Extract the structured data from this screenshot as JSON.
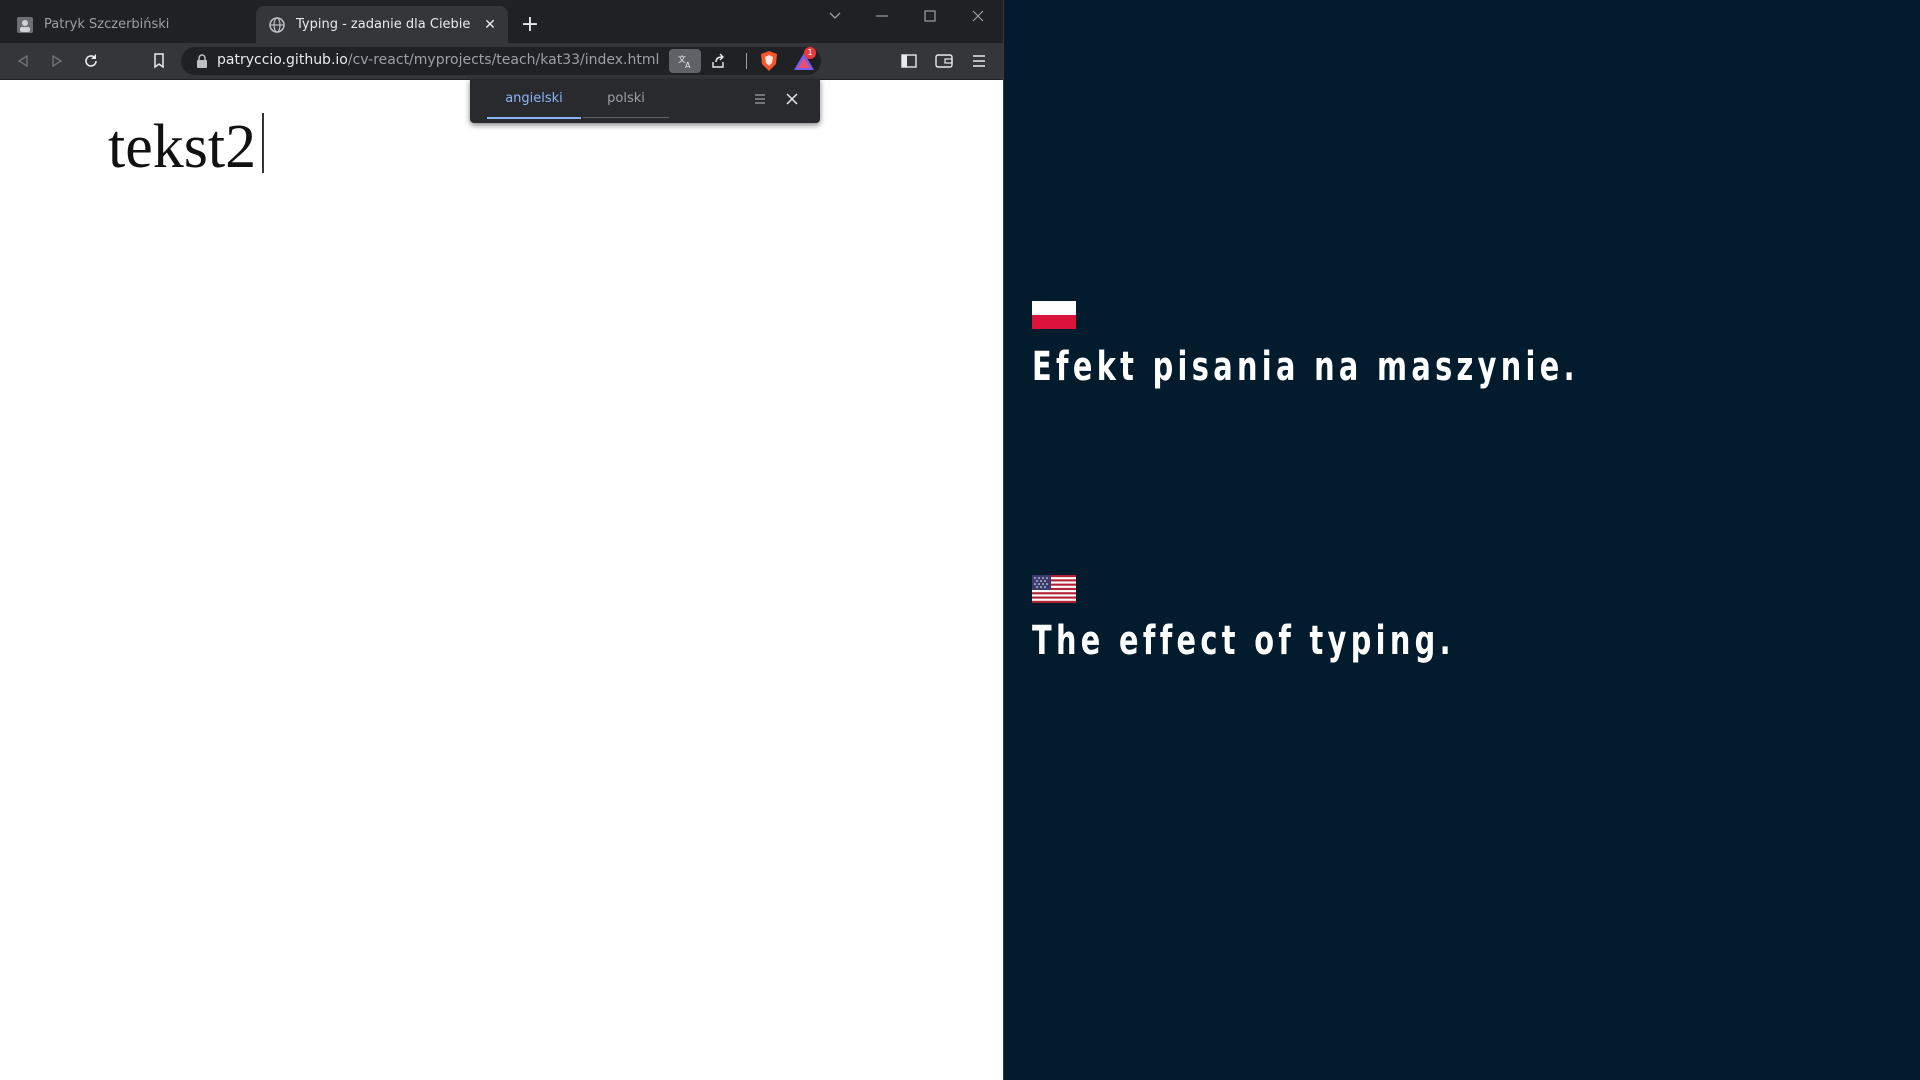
{
  "browser": {
    "tabs": [
      {
        "label": "Patryk Szczerbiński",
        "active": false,
        "icon": "avatar-favicon"
      },
      {
        "label": "Typing - zadanie dla Ciebie",
        "active": true,
        "icon": "globe-favicon"
      }
    ],
    "url": {
      "host": "patryccio.github.io",
      "path": "/cv-react/myprojects/teach/kat33/index.html"
    },
    "rewards_badge": "1"
  },
  "translate_popup": {
    "languages": [
      "angielski",
      "polski"
    ],
    "selected": "angielski"
  },
  "page": {
    "typed_text": "tekst2"
  },
  "captions": {
    "polish": "Efekt pisania na maszynie.",
    "english": "The effect of typing."
  },
  "colors": {
    "background": "#021b2d",
    "accent": "#8ab4f8"
  }
}
